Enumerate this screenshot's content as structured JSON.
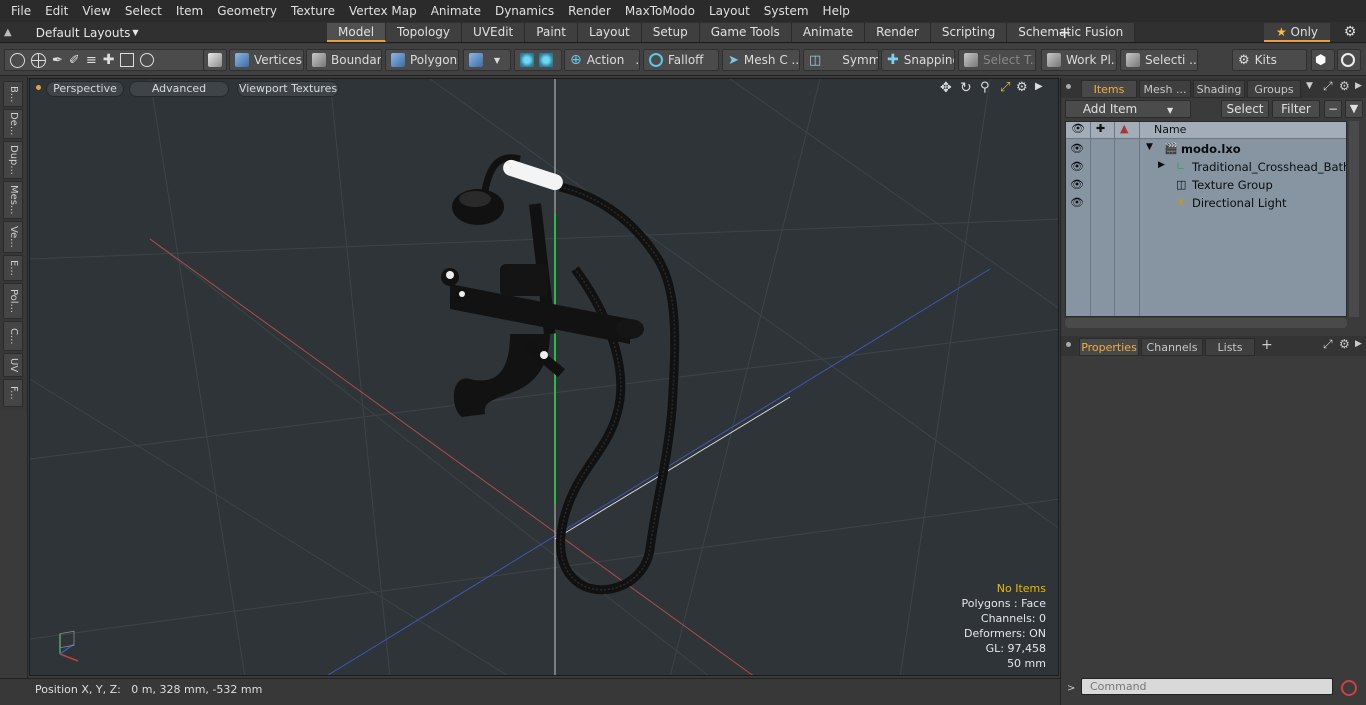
{
  "menu": [
    "File",
    "Edit",
    "View",
    "Select",
    "Item",
    "Geometry",
    "Texture",
    "Vertex Map",
    "Animate",
    "Dynamics",
    "Render",
    "MaxToModo",
    "Layout",
    "System",
    "Help"
  ],
  "layout_selector": "Default Layouts",
  "mode_tabs": [
    {
      "label": "Model",
      "active": true
    },
    {
      "label": "Topology"
    },
    {
      "label": "UVEdit"
    },
    {
      "label": "Paint"
    },
    {
      "label": "Layout"
    },
    {
      "label": "Setup"
    },
    {
      "label": "Game Tools"
    },
    {
      "label": "Animate"
    },
    {
      "label": "Render"
    },
    {
      "label": "Scripting"
    },
    {
      "label": "Schematic Fusion"
    }
  ],
  "only_label": "Only",
  "toolbar": {
    "vertices": "Vertices",
    "boundary": "Boundary",
    "polygons": "Polygons",
    "action": "Action",
    "falloff": "Falloff",
    "mesh": "Mesh C ...",
    "symm": "Symm ...",
    "snapping": "Snapping",
    "select_t": "Select T...",
    "work_pl": "Work Pl...",
    "selecti": "Selecti ...",
    "kits": "Kits"
  },
  "left_tabs": [
    "B...",
    "De...",
    "Dup...",
    "Mes...",
    "Ve...",
    "E...",
    "Pol...",
    "C...",
    "UV",
    "F..."
  ],
  "viewport": {
    "perspective": "Perspective",
    "advanced": "Advanced",
    "textures": "Viewport Textures"
  },
  "stats": {
    "no_items": "No Items",
    "polygons": "Polygons : Face",
    "channels": "Channels: 0",
    "deformers": "Deformers: ON",
    "gl": "GL: 97,458",
    "scale": "50 mm"
  },
  "status": "Position X, Y, Z:   0 m, 328 mm, -532 mm",
  "panel_tabs": [
    "Items",
    "Mesh ...",
    "Shading",
    "Groups"
  ],
  "add_item": "Add Item",
  "select_btn": "Select",
  "filter_btn": "Filter",
  "tree_header": "Name",
  "tree_rows": [
    "modo.lxo",
    "Traditional_Crosshead_Bath_...",
    "Texture Group",
    "Directional Light"
  ],
  "bottom_tabs": [
    "Properties",
    "Channels",
    "Lists"
  ],
  "command_placeholder": "Command",
  "colors": {
    "accent": "#e9a23b",
    "viewport_bg": "#2e3438",
    "tree_bg": "#8795a3",
    "stats_highlight": "#f0b800"
  }
}
